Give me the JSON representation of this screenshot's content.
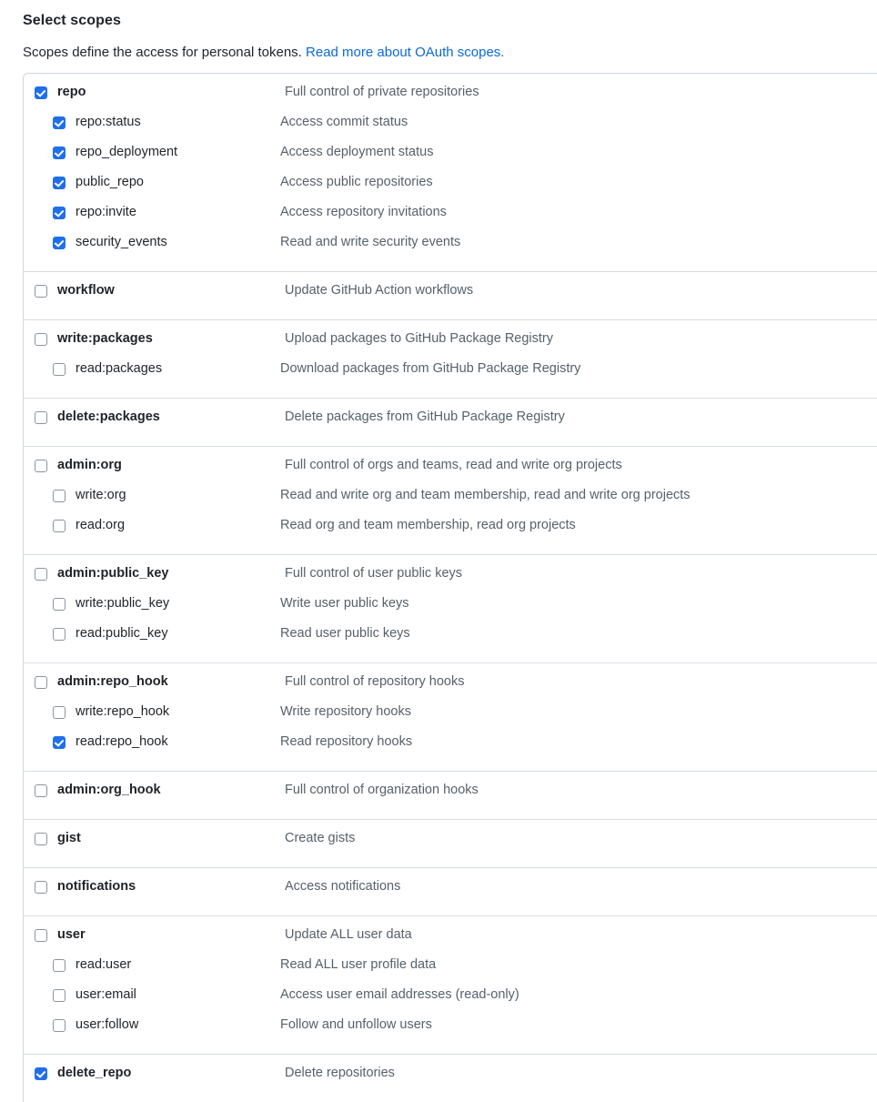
{
  "header": {
    "title": "Select scopes",
    "description_prefix": "Scopes define the access for personal tokens. ",
    "link_text": "Read more about OAuth scopes."
  },
  "colors": {
    "checkbox_checked": "#1f6feb",
    "link": "#0969da",
    "label_text": "#1f2328",
    "description_text": "#57606a",
    "border": "#d0d7de"
  },
  "scope_groups": [
    {
      "rows": [
        {
          "level": "parent",
          "checked": true,
          "label": "repo",
          "description": "Full control of private repositories"
        },
        {
          "level": "child",
          "checked": true,
          "label": "repo:status",
          "description": "Access commit status"
        },
        {
          "level": "child",
          "checked": true,
          "label": "repo_deployment",
          "description": "Access deployment status"
        },
        {
          "level": "child",
          "checked": true,
          "label": "public_repo",
          "description": "Access public repositories"
        },
        {
          "level": "child",
          "checked": true,
          "label": "repo:invite",
          "description": "Access repository invitations"
        },
        {
          "level": "child",
          "checked": true,
          "label": "security_events",
          "description": "Read and write security events"
        }
      ]
    },
    {
      "rows": [
        {
          "level": "parent",
          "checked": false,
          "label": "workflow",
          "description": "Update GitHub Action workflows"
        }
      ]
    },
    {
      "rows": [
        {
          "level": "parent",
          "checked": false,
          "label": "write:packages",
          "description": "Upload packages to GitHub Package Registry"
        },
        {
          "level": "child",
          "checked": false,
          "label": "read:packages",
          "description": "Download packages from GitHub Package Registry"
        }
      ]
    },
    {
      "rows": [
        {
          "level": "parent",
          "checked": false,
          "label": "delete:packages",
          "description": "Delete packages from GitHub Package Registry"
        }
      ]
    },
    {
      "rows": [
        {
          "level": "parent",
          "checked": false,
          "label": "admin:org",
          "description": "Full control of orgs and teams, read and write org projects"
        },
        {
          "level": "child",
          "checked": false,
          "label": "write:org",
          "description": "Read and write org and team membership, read and write org projects"
        },
        {
          "level": "child",
          "checked": false,
          "label": "read:org",
          "description": "Read org and team membership, read org projects"
        }
      ]
    },
    {
      "rows": [
        {
          "level": "parent",
          "checked": false,
          "label": "admin:public_key",
          "description": "Full control of user public keys"
        },
        {
          "level": "child",
          "checked": false,
          "label": "write:public_key",
          "description": "Write user public keys"
        },
        {
          "level": "child",
          "checked": false,
          "label": "read:public_key",
          "description": "Read user public keys"
        }
      ]
    },
    {
      "rows": [
        {
          "level": "parent",
          "checked": false,
          "label": "admin:repo_hook",
          "description": "Full control of repository hooks"
        },
        {
          "level": "child",
          "checked": false,
          "label": "write:repo_hook",
          "description": "Write repository hooks"
        },
        {
          "level": "child",
          "checked": true,
          "label": "read:repo_hook",
          "description": "Read repository hooks"
        }
      ]
    },
    {
      "rows": [
        {
          "level": "parent",
          "checked": false,
          "label": "admin:org_hook",
          "description": "Full control of organization hooks"
        }
      ]
    },
    {
      "rows": [
        {
          "level": "parent",
          "checked": false,
          "label": "gist",
          "description": "Create gists"
        }
      ]
    },
    {
      "rows": [
        {
          "level": "parent",
          "checked": false,
          "label": "notifications",
          "description": "Access notifications"
        }
      ]
    },
    {
      "rows": [
        {
          "level": "parent",
          "checked": false,
          "label": "user",
          "description": "Update ALL user data"
        },
        {
          "level": "child",
          "checked": false,
          "label": "read:user",
          "description": "Read ALL user profile data"
        },
        {
          "level": "child",
          "checked": false,
          "label": "user:email",
          "description": "Access user email addresses (read-only)"
        },
        {
          "level": "child",
          "checked": false,
          "label": "user:follow",
          "description": "Follow and unfollow users"
        }
      ]
    },
    {
      "rows": [
        {
          "level": "parent",
          "checked": true,
          "label": "delete_repo",
          "description": "Delete repositories"
        }
      ]
    }
  ]
}
